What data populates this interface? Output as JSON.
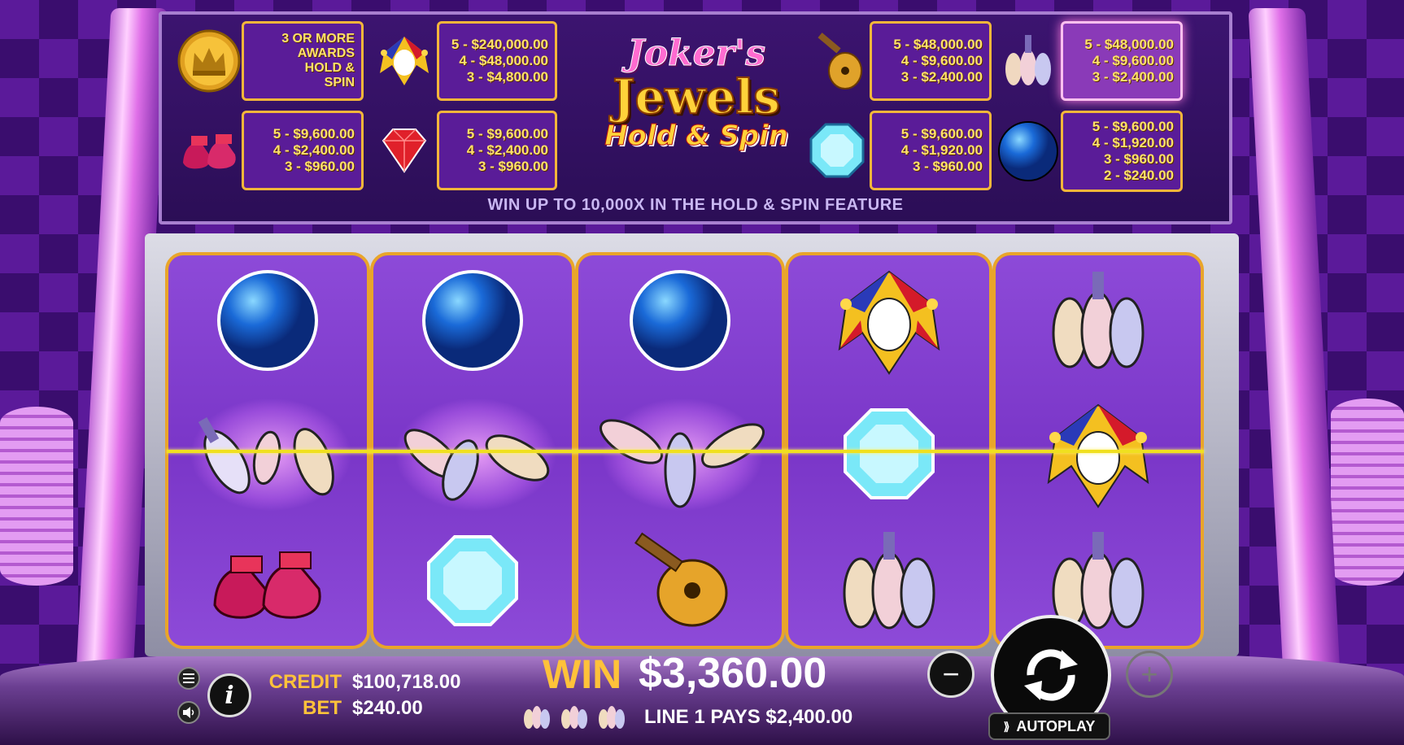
{
  "game": {
    "logo": {
      "line1": "Joker's",
      "line2": "Jewels",
      "line3": "Hold & Spin"
    },
    "feature_text": "WIN UP TO 10,000X IN THE HOLD & SPIN FEATURE"
  },
  "paytable": [
    {
      "symbol": "crown-coin-icon",
      "lines": [
        "3 OR MORE",
        "AWARDS",
        "HOLD &",
        "SPIN"
      ]
    },
    {
      "symbol": "joker-icon",
      "lines": [
        "5 - $240,000.00",
        "4 - $48,000.00",
        "3 - $4,800.00"
      ]
    },
    {
      "symbol": "lute-icon",
      "lines": [
        "5 - $48,000.00",
        "4 - $9,600.00",
        "3 - $2,400.00"
      ]
    },
    {
      "symbol": "pins-icon",
      "lines": [
        "5 - $48,000.00",
        "4 - $9,600.00",
        "3 - $2,400.00"
      ],
      "highlight": true
    },
    {
      "symbol": "shoes-icon",
      "lines": [
        "5 - $9,600.00",
        "4 - $2,400.00",
        "3 - $960.00"
      ]
    },
    {
      "symbol": "ruby-icon",
      "lines": [
        "5 - $9,600.00",
        "4 - $2,400.00",
        "3 - $960.00"
      ]
    },
    {
      "symbol": "diamond-icon",
      "lines": [
        "5 - $9,600.00",
        "4 - $1,920.00",
        "3 - $960.00"
      ]
    },
    {
      "symbol": "blue-ball-icon",
      "lines": [
        "5 - $9,600.00",
        "4 - $1,920.00",
        "3 - $960.00",
        "2 - $240.00"
      ]
    }
  ],
  "reels": [
    [
      "blue-ball-icon",
      "pins-icon",
      "shoes-icon"
    ],
    [
      "blue-ball-icon",
      "pins-icon",
      "diamond-icon"
    ],
    [
      "blue-ball-icon",
      "pins-icon",
      "lute-icon"
    ],
    [
      "joker-icon",
      "diamond-icon",
      "pins-icon"
    ],
    [
      "pins-icon",
      "joker-icon",
      "pins-icon"
    ]
  ],
  "hud": {
    "credit_label": "CREDIT",
    "credit_value": "$100,718.00",
    "bet_label": "BET",
    "bet_value": "$240.00",
    "win_label": "WIN",
    "win_value": "$3,360.00",
    "line_pays": "LINE 1 PAYS $2,400.00",
    "autoplay_label": "AUTOPLAY",
    "info_label": "i",
    "minus_label": "−",
    "plus_label": "+"
  },
  "colors": {
    "gold": "#ffc23a",
    "reel_bg": "#7a36c8",
    "payline": "#f0e020"
  }
}
